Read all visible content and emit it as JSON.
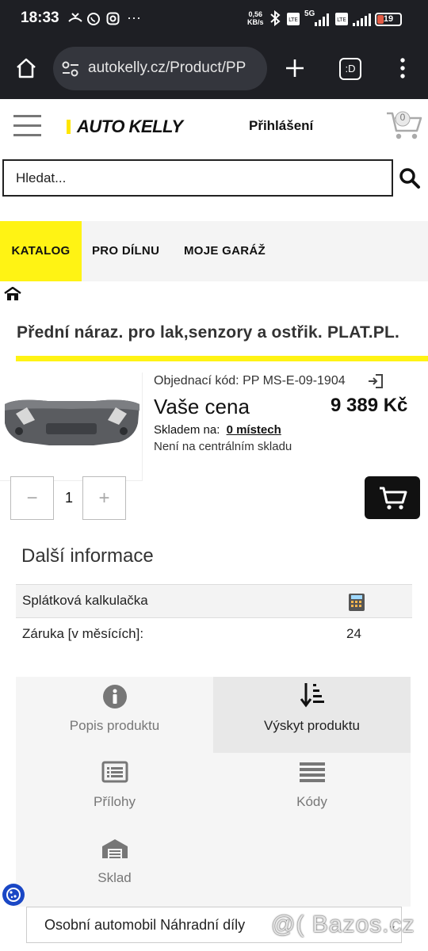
{
  "status_bar": {
    "time": "18:33",
    "net_speed_value": "0,56",
    "net_speed_unit": "KB/s",
    "network": "5G",
    "battery": "19"
  },
  "browser": {
    "url": "autokelly.cz/Product/PP",
    "tab_label": ":D"
  },
  "header": {
    "logo_text": "AUTO KELLY",
    "login_label": "Přihlášení",
    "cart_count": "0"
  },
  "search": {
    "placeholder": "Hledat..."
  },
  "nav": {
    "tabs": [
      "KATALOG",
      "PRO DÍLNU",
      "MOJE GARÁŽ"
    ]
  },
  "product": {
    "title": "Přední náraz. pro lak,senzory a ostřik. PLAT.PL.",
    "order_code_label": "Objednací kód:",
    "order_code": "PP MS-E-09-1904",
    "price_label": "Vaše cena",
    "price": "9 389 Kč",
    "stock_label": "Skladem na:",
    "stock_link": "0 místech",
    "central_stock": "Není na centrálním skladu",
    "quantity": "1",
    "minus": "−",
    "plus": "+"
  },
  "further_info": {
    "title": "Další informace",
    "rows": [
      {
        "label": "Splátková kalkulačka",
        "value": ""
      },
      {
        "label": "Záruka [v měsících]:",
        "value": "24"
      }
    ]
  },
  "tiles": [
    {
      "label": "Popis produktu",
      "icon": "info-icon"
    },
    {
      "label": "Výskyt produktu",
      "icon": "sort-down-icon"
    },
    {
      "label": "Přílohy",
      "icon": "list-icon"
    },
    {
      "label": "Kódy",
      "icon": "lines-icon"
    },
    {
      "label": "Sklad",
      "icon": "warehouse-icon"
    }
  ],
  "vehicle_select": {
    "value": "Osobní automobil Náhradní díly"
  },
  "watermark": "@( Bazos.cz",
  "colors": {
    "brand_yellow": "#fff314",
    "dark_bar": "#1e1f24"
  }
}
